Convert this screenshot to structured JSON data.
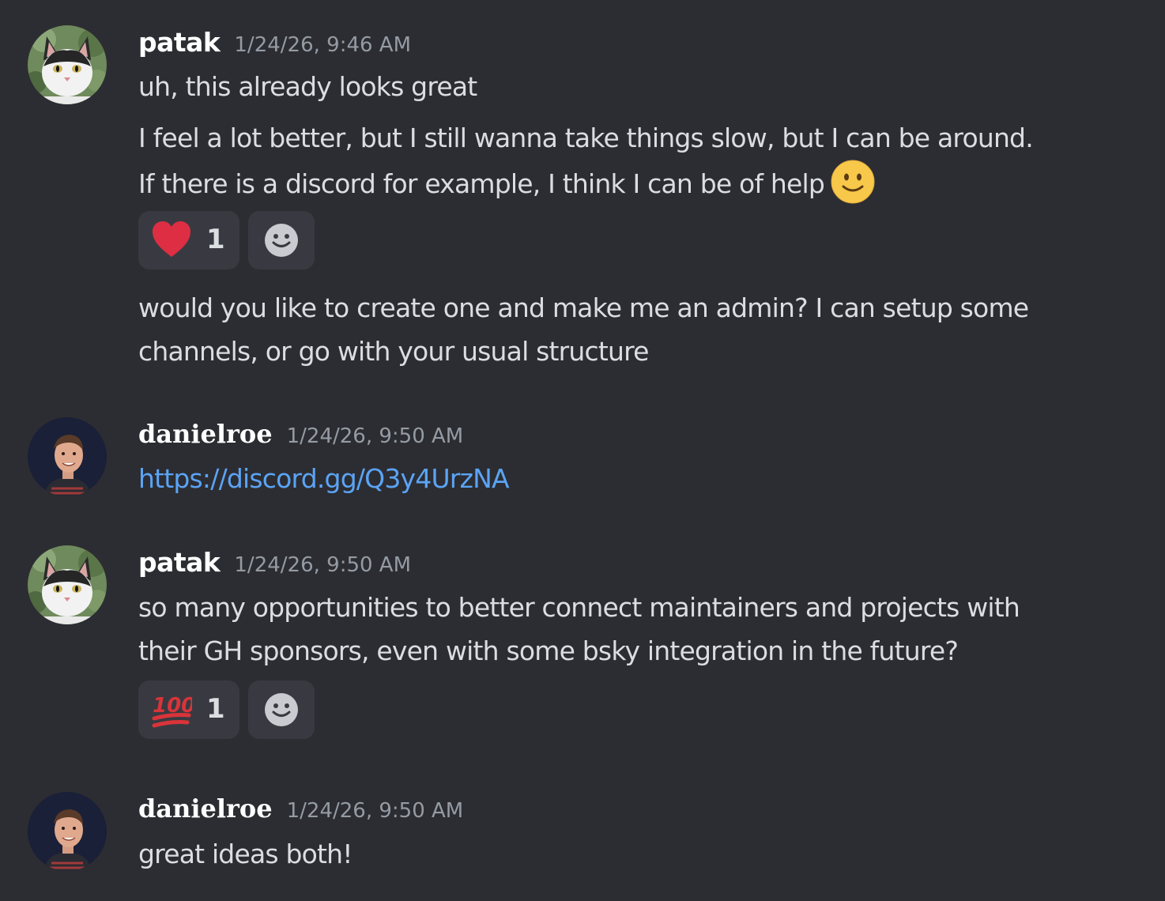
{
  "messages": [
    {
      "author": "patak",
      "timestamp": "1/24/26, 9:46 AM",
      "avatar": "cat-avatar",
      "lines": [
        "uh, this already looks great",
        "I feel a lot better, but I still wanna take things slow, but I can be around.",
        "If there is a discord for example, I think I can be of help"
      ],
      "inline_emoji": "slightly-smiling-face-emoji",
      "reaction": {
        "emoji": "red-heart-emoji",
        "count": "1"
      },
      "after_lines": [
        "would you like to create one and make me an admin? I can setup some",
        "channels, or go with your usual structure"
      ]
    },
    {
      "author": "danielroe",
      "timestamp": "1/24/26, 9:50 AM",
      "avatar": "person-avatar",
      "link": "https://discord.gg/Q3y4UrzNA"
    },
    {
      "author": "patak",
      "timestamp": "1/24/26, 9:50 AM",
      "avatar": "cat-avatar",
      "lines": [
        "so many opportunities to better connect maintainers and projects with",
        "their GH sponsors, even with some bsky integration in the future?"
      ],
      "reaction": {
        "emoji": "hundred-points-emoji",
        "count": "1"
      }
    },
    {
      "author": "danielroe",
      "timestamp": "1/24/26, 9:50 AM",
      "avatar": "person-avatar",
      "lines": [
        "great ideas both!"
      ]
    }
  ],
  "colors": {
    "background": "#2c2d32",
    "username": "#ffffff",
    "timestamp": "#949ba4",
    "text": "#dbdee1",
    "link": "#5ba4f5",
    "reaction_bg": "#393a41"
  }
}
